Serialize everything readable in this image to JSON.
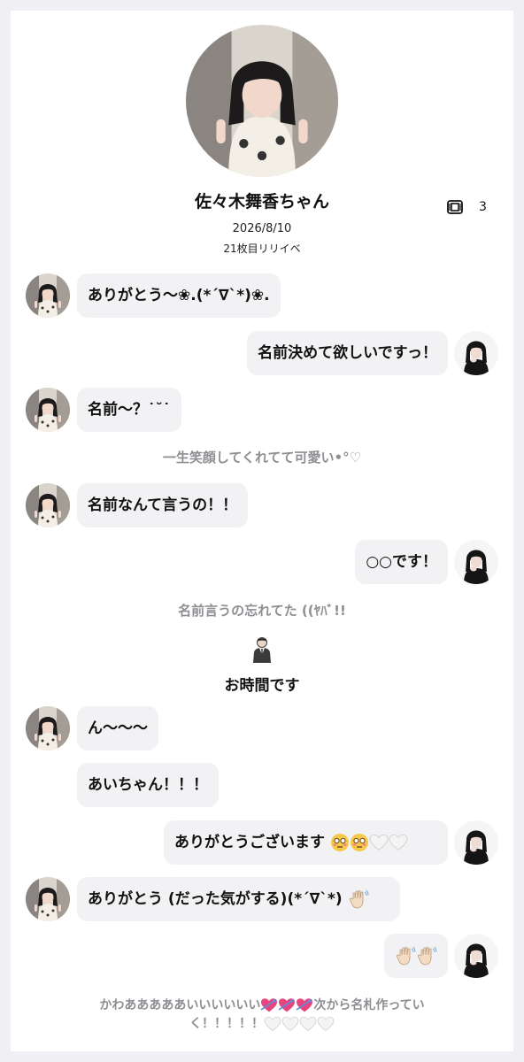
{
  "profile": {
    "name": "佐々木舞香ちゃん",
    "ticket_count": "3",
    "date": "2026/8/10",
    "event": "21枚目リリイベ"
  },
  "messages": [
    {
      "side": "left",
      "text": "ありがとう〜❀.(*´∇`*)❀."
    },
    {
      "side": "right",
      "text": "名前決めて欲しいですっ！"
    },
    {
      "side": "left",
      "text": "名前〜？˙˘˙"
    },
    {
      "side": "note",
      "text": "一生笑顔してくれてて可愛い•°♡"
    },
    {
      "side": "left",
      "text": "名前なんて言うの！！"
    },
    {
      "side": "right",
      "text": "○○です！"
    },
    {
      "side": "note",
      "text": "名前言うの忘れてた ((ﾔﾊﾞ!!"
    },
    {
      "side": "left",
      "text": "ん〜〜〜"
    },
    {
      "side": "left",
      "text": "あいちゃん！！！"
    },
    {
      "side": "right",
      "text": "ありがとうございます"
    },
    {
      "side": "left",
      "text": "ありがとう (だった気がする)(*´∇`*)"
    },
    {
      "side": "note",
      "text": "かわあああああいいいいいい"
    },
    {
      "side": "note",
      "text": "次から名札作ってい"
    },
    {
      "side": "note",
      "text": "く！！！！！"
    }
  ],
  "staff": {
    "label": "お時間です",
    "icon": "staff-person-icon"
  },
  "icons": {
    "ticket": "ticket-icon",
    "emoji_flushed": "flushed-face-emoji",
    "emoji_heart_white": "white-heart-emoji",
    "emoji_wave": "waving-hand-emoji",
    "emoji_heart_arrow": "heart-with-arrow-emoji"
  },
  "colors": {
    "background": "#efeff4",
    "bubble": "#f2f2f4",
    "note_text": "#8e8e93"
  }
}
